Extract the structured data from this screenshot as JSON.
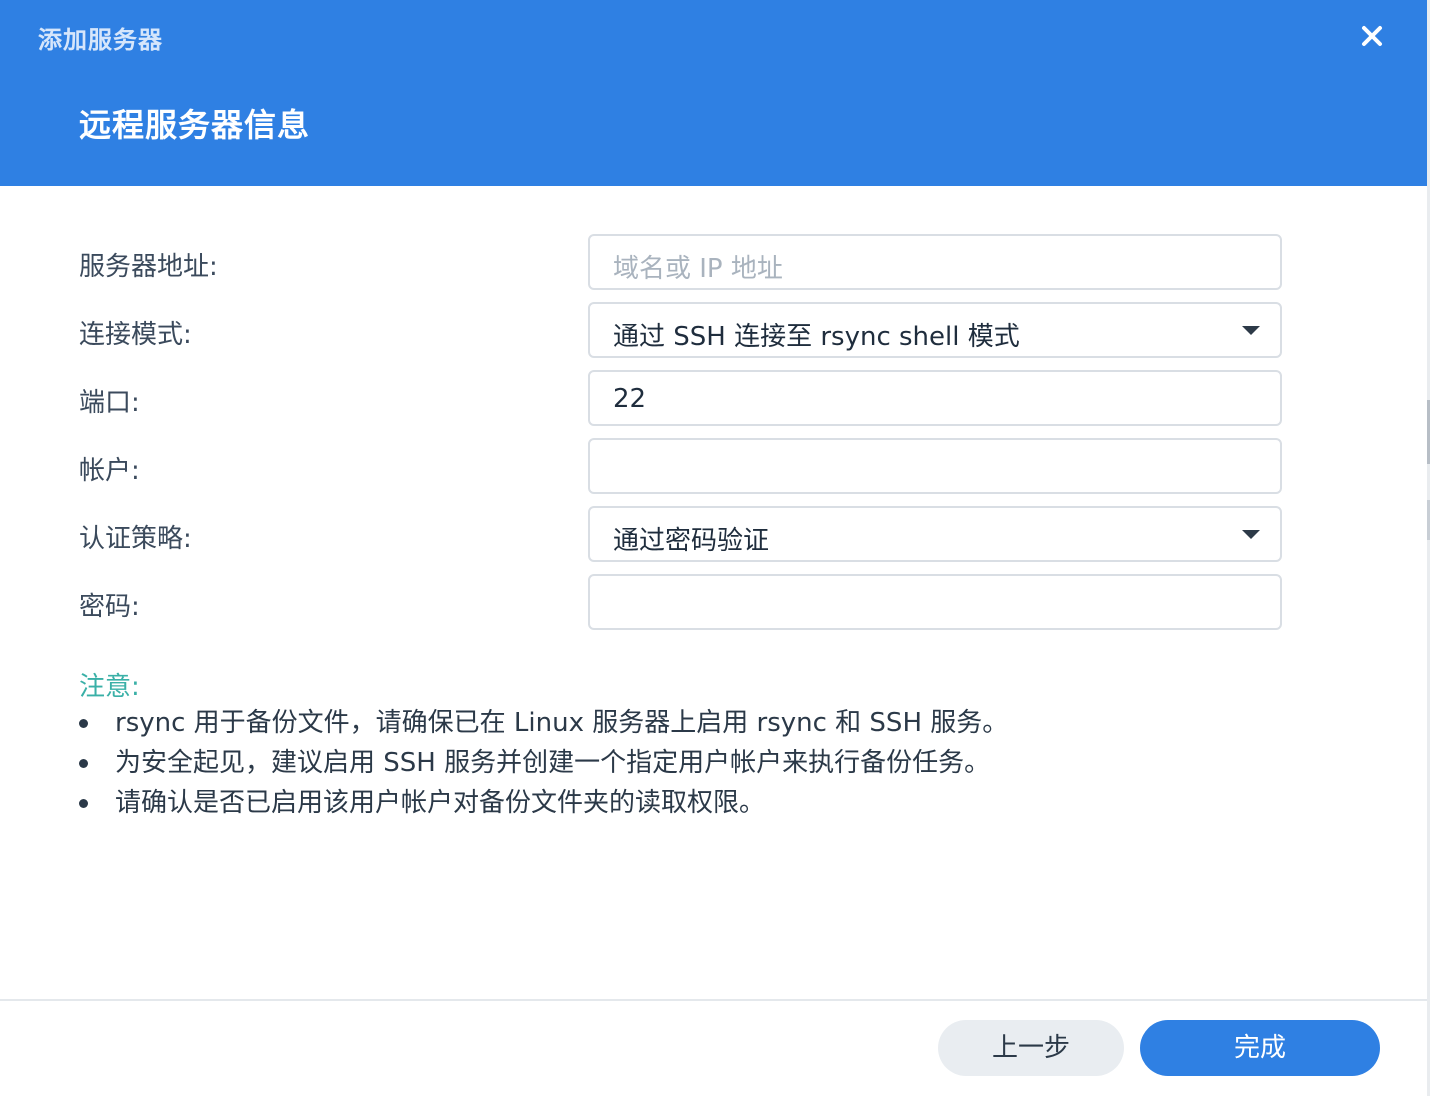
{
  "window": {
    "title": "添加服务器",
    "section_title": "远程服务器信息"
  },
  "form": {
    "server_address": {
      "label": "服务器地址:",
      "value": "",
      "placeholder": "域名或 IP 地址"
    },
    "connection_mode": {
      "label": "连接模式:",
      "value": "通过 SSH 连接至 rsync shell 模式"
    },
    "port": {
      "label": "端口:",
      "value": "22"
    },
    "account": {
      "label": "帐户:",
      "value": ""
    },
    "auth_policy": {
      "label": "认证策略:",
      "value": "通过密码验证"
    },
    "password": {
      "label": "密码:",
      "value": ""
    }
  },
  "notes": {
    "title": "注意:",
    "items": [
      "rsync 用于备份文件，请确保已在 Linux 服务器上启用 rsync 和 SSH 服务。",
      "为安全起见，建议启用 SSH 服务并创建一个指定用户帐户来执行备份任务。",
      "请确认是否已启用该用户帐户对备份文件夹的读取权限。"
    ]
  },
  "buttons": {
    "back": "上一步",
    "finish": "完成"
  },
  "colors": {
    "header": "#2f80e3",
    "note_title": "#3ab0a7",
    "primary_button": "#2f80e3",
    "secondary_button": "#e9edf1"
  },
  "icons": {
    "close": "close-icon",
    "dropdown": "chevron-down-icon",
    "bullet": "bullet-icon"
  }
}
